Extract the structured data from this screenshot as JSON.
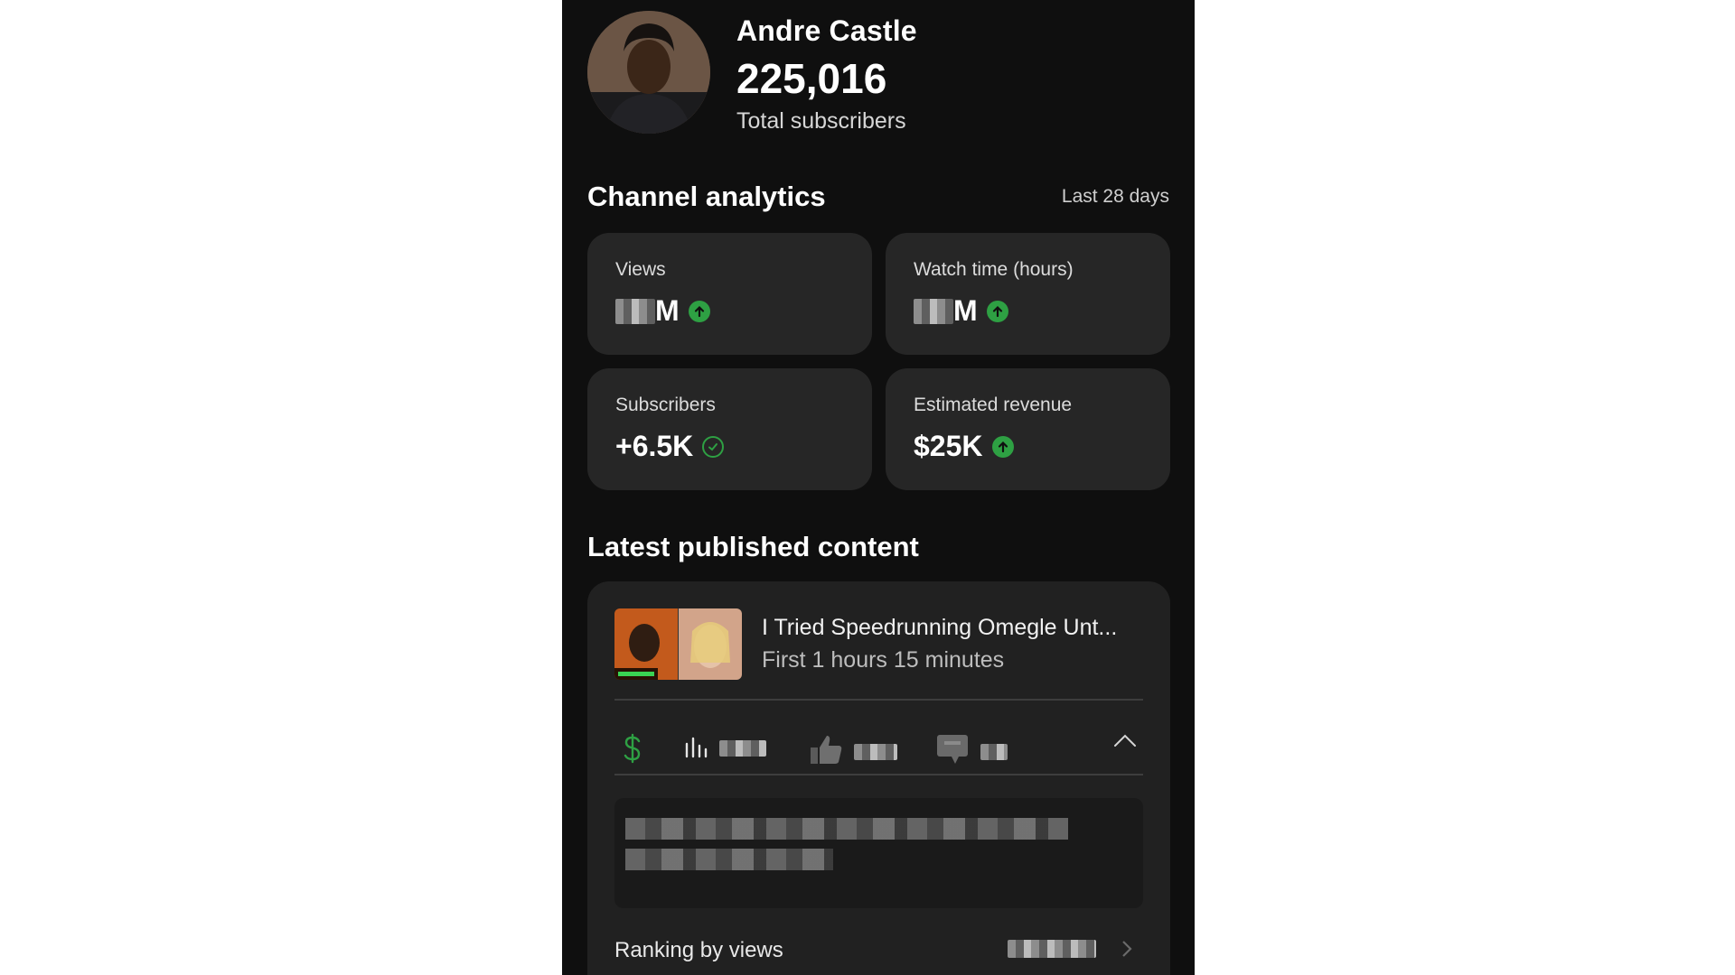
{
  "channel": {
    "name": "Andre Castle",
    "subscriber_count": "225,016",
    "subscriber_label": "Total subscribers"
  },
  "analytics": {
    "title": "Channel analytics",
    "range": "Last 28 days",
    "cards": [
      {
        "label": "Views",
        "value": "M",
        "trend": "up",
        "redacted": true
      },
      {
        "label": "Watch time (hours)",
        "value": "M",
        "trend": "up",
        "redacted": true
      },
      {
        "label": "Subscribers",
        "value": "+6.5K",
        "trend": "check"
      },
      {
        "label": "Estimated revenue",
        "value": "$25K",
        "trend": "up"
      }
    ]
  },
  "latest": {
    "title": "Latest published content",
    "video_title": "I Tried Speedrunning Omegle Unt...",
    "video_subtitle": "First 1 hours 15 minutes",
    "ranking_label": "Ranking by views"
  },
  "colors": {
    "background": "#0f0f0f",
    "card": "#262626",
    "accent_green": "#2ea043"
  },
  "icons": [
    "dollar-icon",
    "bar-chart-icon",
    "thumbs-up-icon",
    "comment-icon",
    "chevron-up-icon",
    "arrow-up-icon",
    "check-circle-icon"
  ]
}
